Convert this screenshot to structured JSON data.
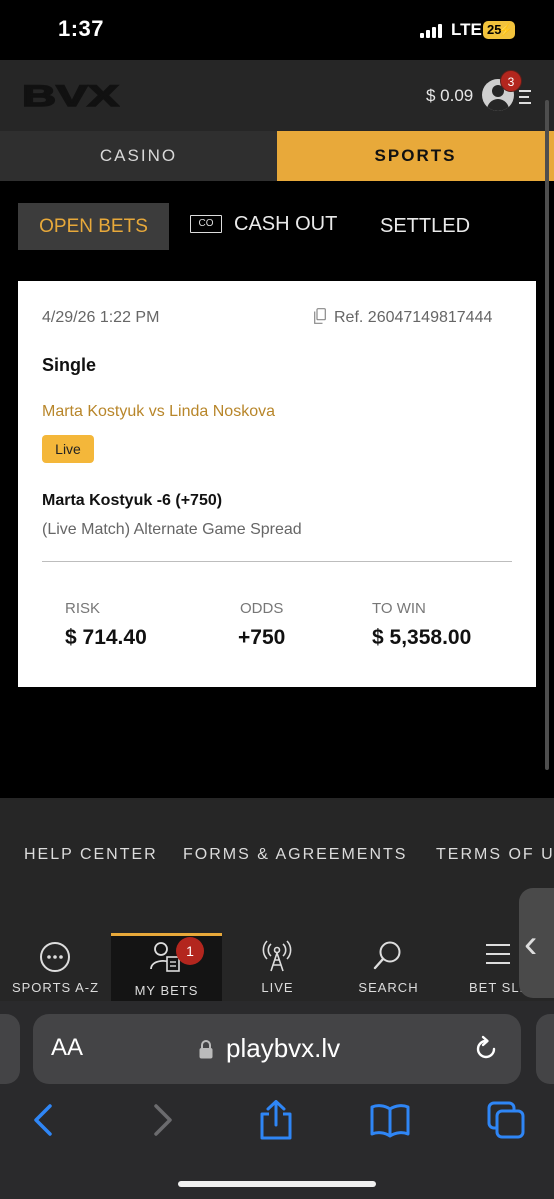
{
  "status_bar": {
    "time": "1:37",
    "network": "LTE",
    "battery": "25"
  },
  "header": {
    "logo": "BVX",
    "balance": "$ 0.09",
    "notification_count": "3"
  },
  "section_tabs": {
    "casino": "CASINO",
    "sports": "SPORTS",
    "active": "SPORTS"
  },
  "bet_tabs": {
    "open": "OPEN BETS",
    "cashout_icon": "CO",
    "cashout": "CASH OUT",
    "settled": "SETTLED",
    "active": "OPEN BETS"
  },
  "bet": {
    "date": "4/29/26 1:22 PM",
    "ref": "Ref. 26047149817444",
    "type": "Single",
    "match": "Marta Kostyuk vs Linda Noskova",
    "badge": "Live",
    "selection": "Marta Kostyuk -6 (+750)",
    "market": "(Live Match) Alternate Game Spread",
    "risk_label": "RISK",
    "risk_value": "$ 714.40",
    "odds_label": "ODDS",
    "odds_value": "+750",
    "towin_label": "TO WIN",
    "towin_value": "$ 5,358.00"
  },
  "footer_links": [
    "HELP CENTER",
    "FORMS & AGREEMENTS",
    "TERMS OF U"
  ],
  "bottom_nav": {
    "items": [
      {
        "label": "SPORTS A-Z",
        "icon": "ellipsis-circle-icon"
      },
      {
        "label": "MY BETS",
        "icon": "user-ticket-icon"
      },
      {
        "label": "LIVE",
        "icon": "broadcast-tower-icon"
      },
      {
        "label": "SEARCH",
        "icon": "search-icon"
      },
      {
        "label": "BET SLI",
        "icon": "bet-slip-icon"
      }
    ],
    "active": "MY BETS",
    "my_bets_badge": "1"
  },
  "browser": {
    "text_size_button": "AA",
    "url": "playbvx.lv"
  },
  "colors": {
    "accent": "#e8a93a",
    "header_bg": "#262626",
    "live_badge": "#f4b73a",
    "match_text": "#b8862a",
    "badge_red": "#b3261e"
  }
}
